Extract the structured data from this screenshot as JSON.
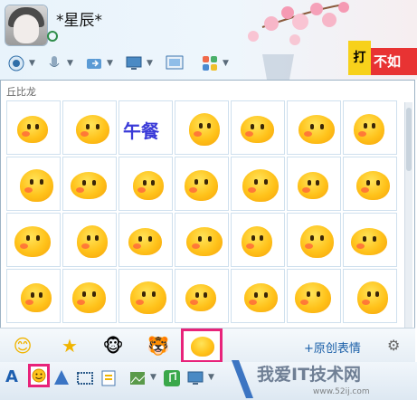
{
  "chat": {
    "contact_name": "*星辰*"
  },
  "banner": {
    "left_text": "打",
    "right_text": "不如"
  },
  "toolbar": {
    "items": [
      {
        "icon": "video-icon"
      },
      {
        "icon": "microphone-icon"
      },
      {
        "icon": "send-file-icon"
      },
      {
        "icon": "remote-assist-icon"
      },
      {
        "icon": "screen-share-icon"
      },
      {
        "icon": "apps-icon"
      }
    ]
  },
  "emoji_panel": {
    "pack_title": "丘比龙",
    "rows": 4,
    "cols": 7,
    "special_cell_text": "午餐",
    "tabs": [
      {
        "icon": "smiley-icon",
        "glyph": "😊"
      },
      {
        "icon": "star-icon",
        "glyph": "★"
      },
      {
        "icon": "monkey-icon",
        "glyph": "🐵"
      },
      {
        "icon": "tiger-icon",
        "glyph": "🐯"
      },
      {
        "icon": "qq-dragon-icon",
        "glyph": ""
      }
    ],
    "add_custom_label": "+原创表情",
    "settings_icon": "gear-icon"
  },
  "input_toolbar": {
    "font_label": "A"
  },
  "watermark": {
    "text": "我爱IT技术网",
    "url": "www.52ij.com"
  },
  "colors": {
    "highlight": "#e8237a",
    "accent": "#1a5fa8"
  }
}
